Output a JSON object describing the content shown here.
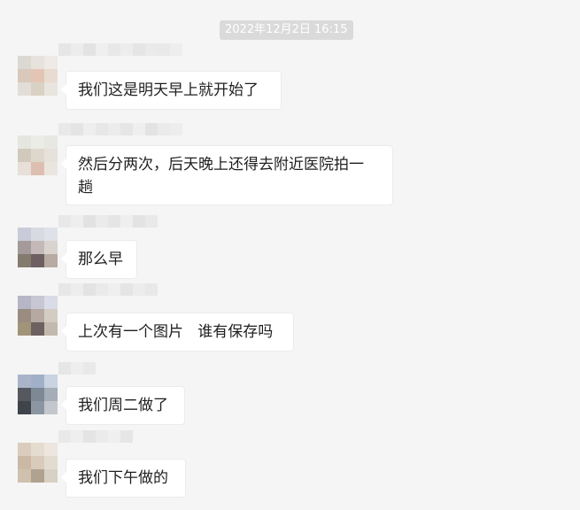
{
  "timestamp": "2022年12月2日 16:15",
  "messages": [
    {
      "text": "我们这是明天早上就开始了"
    },
    {
      "text": "然后分两次，后天晚上还得去附近医院拍一\n趟"
    },
    {
      "text": "那么早"
    },
    {
      "text": "上次有一个图片   谁有保存吗"
    },
    {
      "text": "我们周二做了"
    },
    {
      "text": "我们下午做的"
    }
  ]
}
